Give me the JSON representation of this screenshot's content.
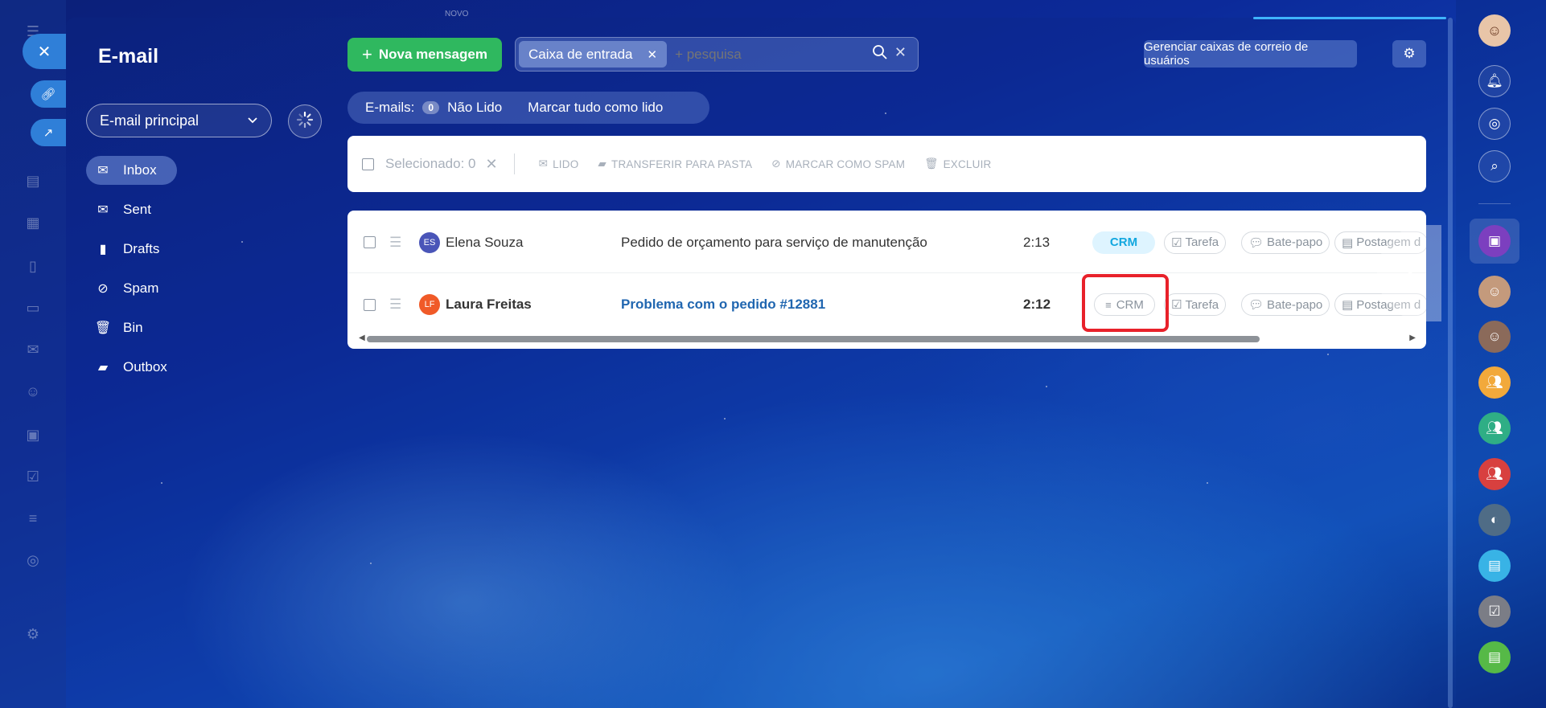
{
  "app": {
    "title": "E-mail",
    "top_partial_label": "NOVO"
  },
  "sidebar": {
    "mailbox": "E-mail principal",
    "folders": [
      {
        "label": "Inbox",
        "icon": "envelope-icon",
        "active": true
      },
      {
        "label": "Sent",
        "icon": "sent-icon",
        "active": false
      },
      {
        "label": "Drafts",
        "icon": "document-icon",
        "active": false
      },
      {
        "label": "Spam",
        "icon": "spam-icon",
        "active": false
      },
      {
        "label": "Bin",
        "icon": "trash-icon",
        "active": false
      },
      {
        "label": "Outbox",
        "icon": "folder-icon",
        "active": false
      }
    ]
  },
  "toolbar": {
    "new_message": "Nova mensagem",
    "filter_chip": "Caixa de entrada",
    "search_placeholder": "+ pesquisa",
    "manage_mailboxes": "Gerenciar caixas de correio de usuários"
  },
  "counters": {
    "emails_label": "E-mails:",
    "unread_count": "0",
    "unread_label": "Não Lido",
    "mark_all": "Marcar tudo como lido"
  },
  "actions": {
    "selected": "Selecionado: 0",
    "read": "LIDO",
    "move": "TRANSFERIR PARA PASTA",
    "spam": "MARCAR COMO SPAM",
    "delete": "EXCLUIR"
  },
  "messages": [
    {
      "initials": "ES",
      "sender": "Elena Souza",
      "subject": "Pedido de orçamento para serviço de manutenção",
      "time": "2:13",
      "crm": "CRM",
      "task": "Tarefa",
      "chat": "Bate-papo",
      "post": "Postagem d",
      "unread": false,
      "avatar_color": "#4a55b8"
    },
    {
      "initials": "LF",
      "sender": "Laura Freitas",
      "subject": "Problema com o pedido #12881",
      "time": "2:12",
      "crm": "CRM",
      "task": "Tarefa",
      "chat": "Bate-papo",
      "post": "Postagem d",
      "unread": true,
      "avatar_color": "#f05a28"
    }
  ],
  "colors": {
    "accent_green": "#2fb85f",
    "crm_active": "#12a7df",
    "highlight": "#e8212a",
    "link_blue": "#2066b0"
  }
}
